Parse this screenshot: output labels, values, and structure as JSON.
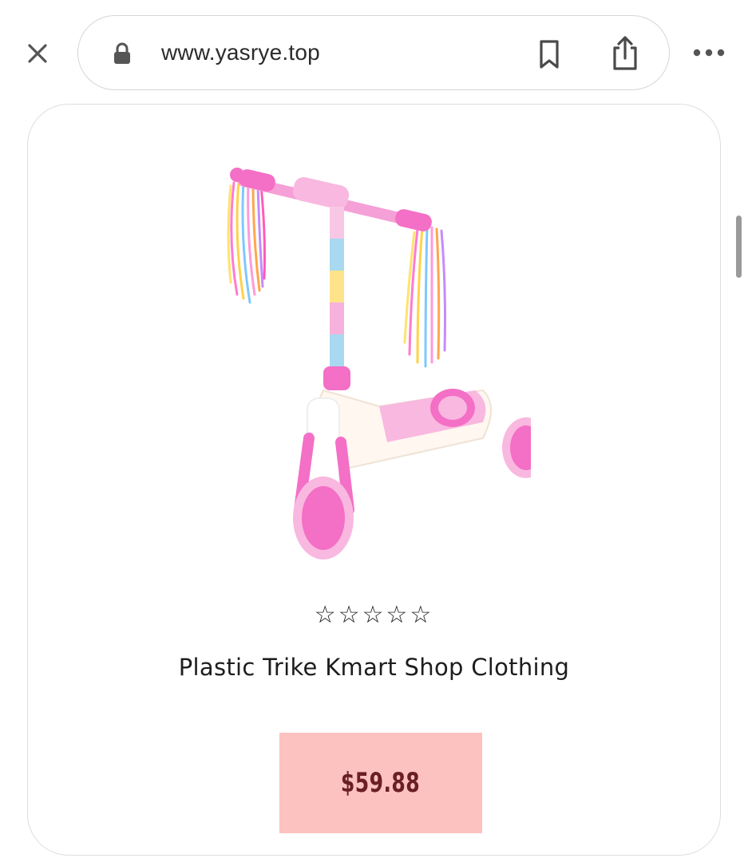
{
  "browser": {
    "url": "www.yasrye.top",
    "icons": {
      "close": "close-icon",
      "lock": "lock-icon",
      "bookmark": "bookmark-icon",
      "share": "share-icon",
      "more": "more-icon"
    }
  },
  "product": {
    "image_icon": "scooter-image",
    "rating": 0,
    "rating_max": 5,
    "stars": "☆☆☆☆☆",
    "title": "Plastic Trike Kmart Shop Clothing",
    "price": "$59.88"
  },
  "colors": {
    "price_bg": "#fcc2c0",
    "price_text": "#6a1f24",
    "scooter_pink": "#f46fc6"
  }
}
